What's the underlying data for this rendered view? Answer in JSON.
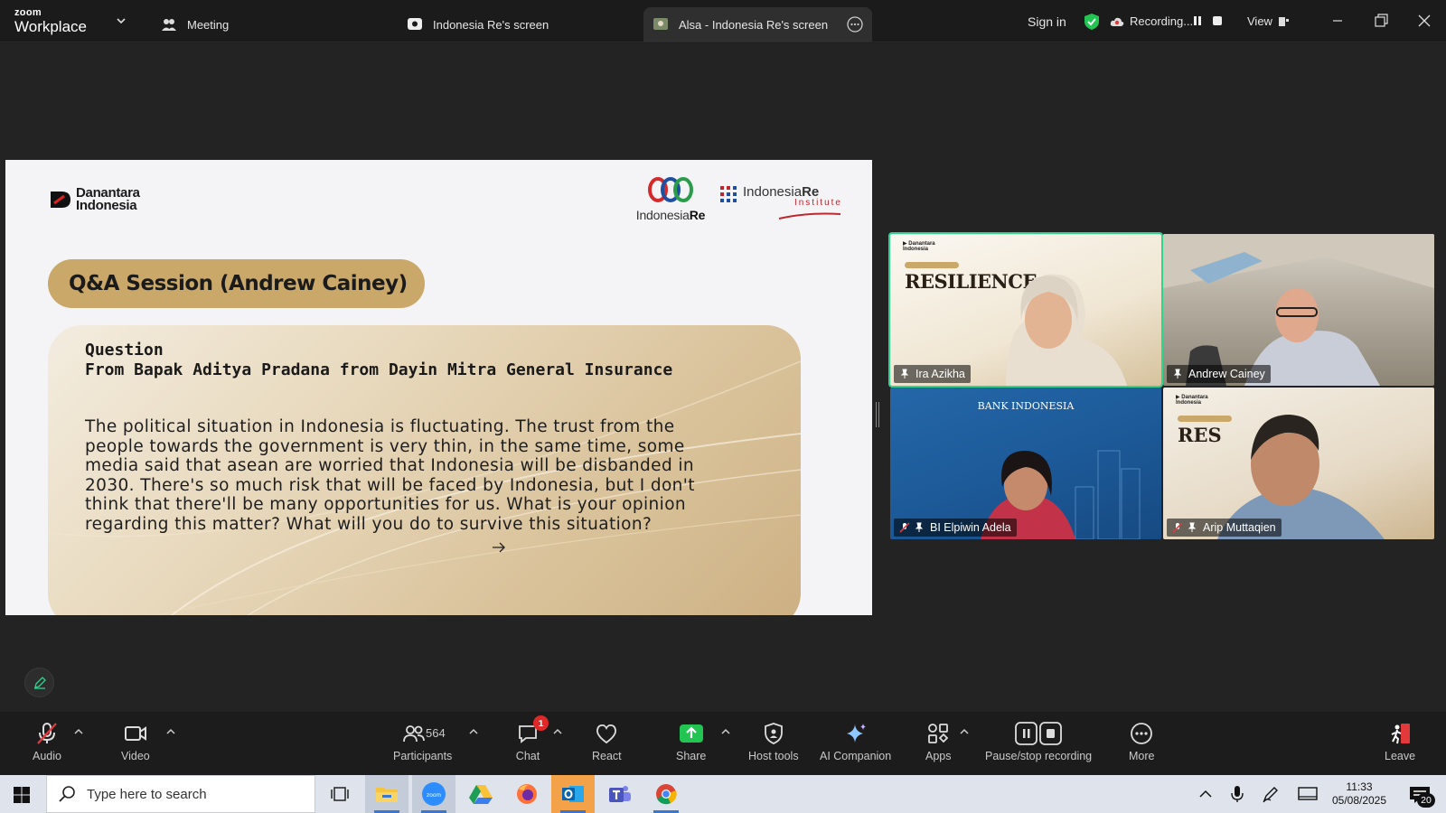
{
  "titlebar": {
    "brand_top": "zoom",
    "brand_bottom": "Workplace",
    "tabs": [
      {
        "label": "Meeting",
        "icon": "people-icon"
      },
      {
        "label": "Indonesia Re's screen",
        "icon": "screen-share-icon"
      },
      {
        "label": "Alsa - Indonesia Re's screen",
        "icon": "screen-share-icon",
        "active": true
      }
    ],
    "sign_in": "Sign in",
    "recording": "Recording...",
    "view": "View",
    "accent": "#2fd58d"
  },
  "slide": {
    "logo_left": [
      "Danantara",
      "Indonesia"
    ],
    "logo_middle": {
      "prefix": "Indonesia",
      "suffix": "Re"
    },
    "logo_right": {
      "prefix": "Indonesia",
      "suffix": "Re",
      "sub": "Institute"
    },
    "session_title": "Q&A Session (Andrew Cainey)",
    "question_label": "Question",
    "question_from": "From Bapak Aditya Pradana from Dayin Mitra General Insurance",
    "question_lines": [
      "The political situation in Indonesia is fluctuating. The trust from the",
      "people towards the government is very thin, in the same time, some",
      "media said that asean are worried that Indonesia will be disbanded in",
      "2030. There's so much risk that will be faced by Indonesia, but I don't",
      "think that there'll be many opportunities for us. What is your opinion",
      "regarding this matter? What will you do to survive this situation?"
    ],
    "pill_color": "#c9a86a"
  },
  "gallery": {
    "tiles": [
      {
        "name": "Ira Azikha",
        "muted": false,
        "active": true,
        "bg_title": "RESILIENCE"
      },
      {
        "name": "Andrew Cainey",
        "muted": false,
        "active": false
      },
      {
        "name": "BI Elpiwin Adela",
        "muted": true,
        "active": false,
        "bg_title": "BANK INDONESIA"
      },
      {
        "name": "Arip Muttaqien",
        "muted": true,
        "active": false,
        "bg_title": "RES"
      }
    ]
  },
  "toolbar": {
    "audio": "Audio",
    "video": "Video",
    "participants": "Participants",
    "participants_count": "564",
    "chat": "Chat",
    "chat_badge": "1",
    "react": "React",
    "share": "Share",
    "host_tools": "Host tools",
    "ai_companion": "AI Companion",
    "apps": "Apps",
    "pause_stop": "Pause/stop recording",
    "more": "More",
    "leave": "Leave"
  },
  "taskbar": {
    "search_placeholder": "Type here to search",
    "time": "11:33",
    "date": "05/08/2025",
    "notifications": "20"
  }
}
